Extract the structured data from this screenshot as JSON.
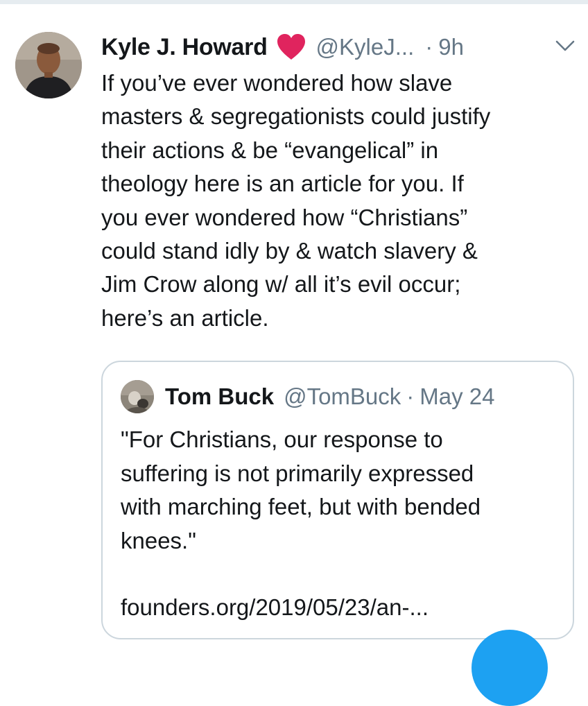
{
  "tweet": {
    "author": {
      "display_name": "Kyle J. Howard",
      "handle": "@KyleJ...",
      "badge_icon": "red-heart-icon",
      "badge_color": "#e0245e"
    },
    "separator": "·",
    "timestamp": "9h",
    "menu_icon": "chevron-down-icon",
    "text": "If you’ve ever wondered how slave\nmasters & segregationists could justify\ntheir actions & be “evangelical” in\ntheology here is an article for you. If\nyou ever wondered how “Christians”\ncould stand idly by & watch slavery &\nJim Crow along w/ all it’s evil occur;\nhere’s an article."
  },
  "quoted_tweet": {
    "author": {
      "display_name": "Tom Buck",
      "handle": "@TomBuck"
    },
    "separator": "·",
    "date": "May 24",
    "text": "\"For Christians, our response to\nsuffering is not primarily expressed\nwith marching feet, but with bended\nknees.\"",
    "link": "founders.org/2019/05/23/an-..."
  },
  "colors": {
    "text_primary": "#14171a",
    "text_secondary": "#657786",
    "border": "#ccd6dd",
    "accent_blue": "#1da1f2"
  }
}
